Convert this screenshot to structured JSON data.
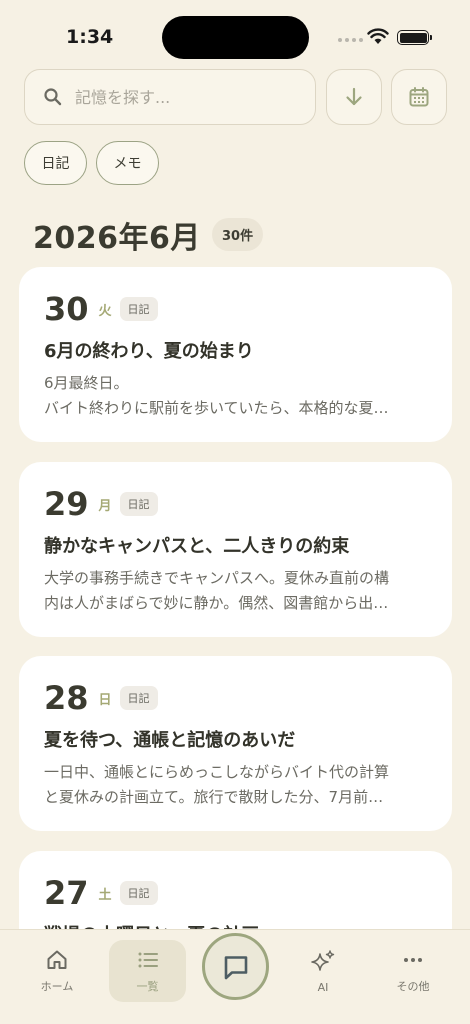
{
  "status": {
    "time": "1:34"
  },
  "search": {
    "placeholder": "記憶を探す..."
  },
  "filters": [
    "日記",
    "メモ"
  ],
  "month": {
    "title": "2026年6月",
    "count": "30件"
  },
  "entries": [
    {
      "day": "30",
      "weekday": "火",
      "tag": "日記",
      "title": "6月の終わり、夏の始まり",
      "line1": "6月最終日。",
      "line2": "バイト終わりに駅前を歩いていたら、本格的な夏…"
    },
    {
      "day": "29",
      "weekday": "月",
      "tag": "日記",
      "title": "静かなキャンパスと、二人きりの約束",
      "line1": "大学の事務手続きでキャンパスへ。夏休み直前の構",
      "line2": "内は人がまばらで妙に静か。偶然、図書館から出…"
    },
    {
      "day": "28",
      "weekday": "日",
      "tag": "日記",
      "title": "夏を待つ、通帳と記憶のあいだ",
      "line1": "一日中、通帳とにらめっこしながらバイト代の計算",
      "line2": "と夏休みの計画立て。旅行で散財した分、7月前…"
    },
    {
      "day": "27",
      "weekday": "土",
      "tag": "日記",
      "title": "戦場の土曜日と、夏の計画",
      "line1": "",
      "line2": ""
    }
  ],
  "tabs": {
    "home": "ホーム",
    "list": "一覧",
    "ai": "AI",
    "more": "その他"
  },
  "colors": {
    "background": "#f6f1e4",
    "accent": "#9da67f",
    "card": "#ffffff"
  }
}
